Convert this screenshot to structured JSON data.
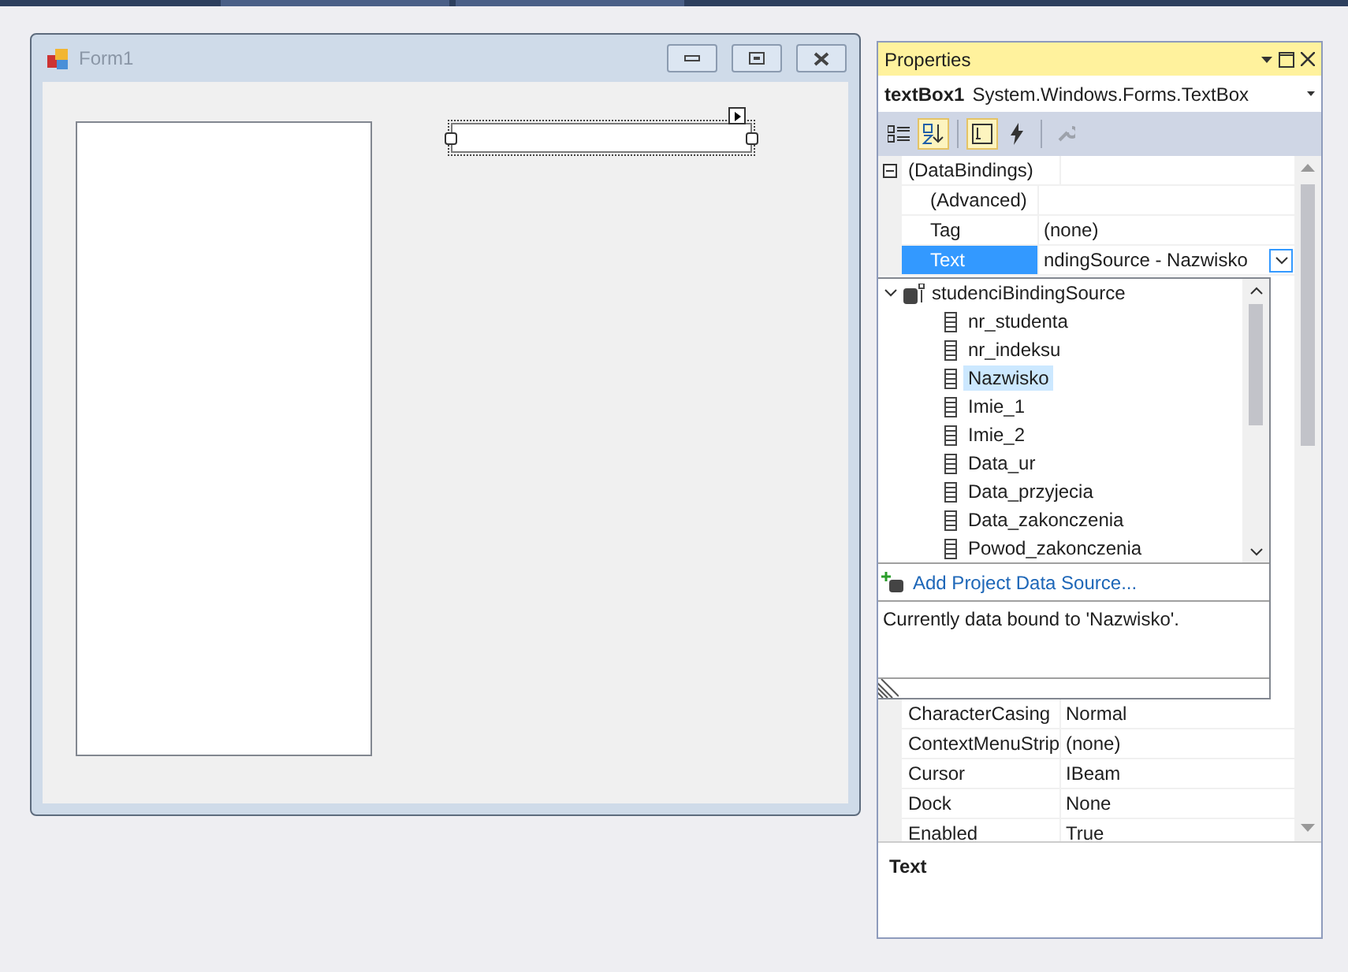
{
  "designer": {
    "form": {
      "title": "Form1",
      "controls": [
        {
          "kind": "listbox",
          "selected": false
        },
        {
          "kind": "textbox",
          "selected": true
        }
      ]
    }
  },
  "properties": {
    "title": "Properties",
    "object_name": "textBox1",
    "object_type": "System.Windows.Forms.TextBox",
    "toolbar": [
      {
        "kind": "categorized",
        "selected": false,
        "disabled": false
      },
      {
        "kind": "alphabetical",
        "selected": true,
        "disabled": false
      },
      {
        "kind": "properties",
        "selected": true,
        "disabled": false
      },
      {
        "kind": "events",
        "selected": false,
        "disabled": false
      },
      {
        "kind": "property-pages",
        "selected": false,
        "disabled": true
      }
    ],
    "category": {
      "name": "(DataBindings)",
      "expanded": true,
      "children": [
        {
          "name": "(Advanced)",
          "selected": false
        },
        {
          "name": "Tag",
          "value": "(none)",
          "selected": false
        },
        {
          "name": "Text",
          "value": "ndingSource - Nazwisko",
          "selected": true
        }
      ]
    },
    "binding_dropdown": {
      "source": {
        "name": "studenciBindingSource",
        "expanded": true,
        "children": [
          {
            "name": "nr_studenta",
            "selected": false
          },
          {
            "name": "nr_indeksu",
            "selected": false
          },
          {
            "name": "Nazwisko",
            "selected": true
          },
          {
            "name": "Imie_1",
            "selected": false
          },
          {
            "name": "Imie_2",
            "selected": false
          },
          {
            "name": "Data_ur",
            "selected": false
          },
          {
            "name": "Data_przyjecia",
            "selected": false
          },
          {
            "name": "Data_zakonczenia",
            "selected": false
          },
          {
            "name": "Powod_zakonczenia",
            "selected": false
          }
        ]
      },
      "link": "Add Project Data Source...",
      "status": "Currently data bound to 'Nazwisko'."
    },
    "rows": [
      {
        "name": "CharacterCasing",
        "value": "Normal"
      },
      {
        "name": "ContextMenuStrip",
        "value": "(none)"
      },
      {
        "name": "Cursor",
        "value": "IBeam"
      },
      {
        "name": "Dock",
        "value": "None"
      },
      {
        "name": "Enabled",
        "value": "True"
      }
    ],
    "description": {
      "title": "Text"
    }
  }
}
